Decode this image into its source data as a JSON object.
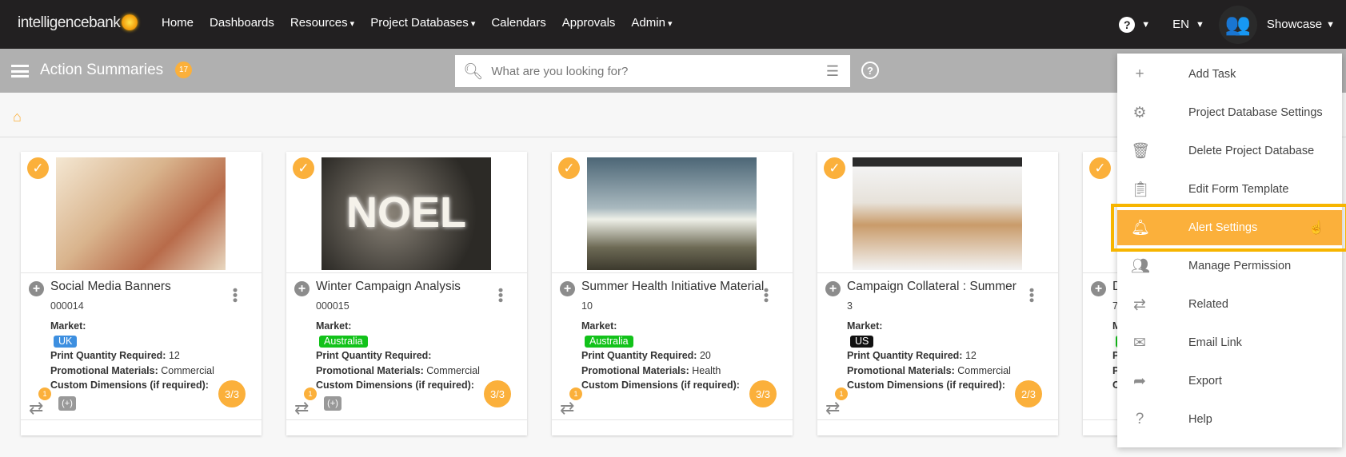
{
  "topbar": {
    "logo": "intelligencebank",
    "nav": [
      "Home",
      "Dashboards",
      "Resources",
      "Project Databases",
      "Calendars",
      "Approvals",
      "Admin"
    ],
    "language": "EN",
    "user": "Showcase"
  },
  "header": {
    "title": "Action Summaries",
    "count": "17",
    "search_placeholder": "What are you looking for?"
  },
  "labels": {
    "market": "Market:",
    "print_qty": "Print Quantity Required:",
    "promo": "Promotional Materials:",
    "custom_dims": "Custom Dimensions (if required):"
  },
  "cards": [
    {
      "title": "Social Media Banners",
      "id": "000014",
      "market": "UK",
      "market_color": "#3d8fe0",
      "print_qty": "12",
      "promo": "Commercial",
      "related": "1",
      "progress": "3/3"
    },
    {
      "title": "Winter Campaign Analysis",
      "id": "000015",
      "market": "Australia",
      "market_color": "#12c21a",
      "print_qty": "",
      "promo": "Commercial",
      "related": "1",
      "progress": "3/3",
      "image_text": "NOEL"
    },
    {
      "title": "Summer Health Initiative Material",
      "id": "10",
      "market": "Australia",
      "market_color": "#12c21a",
      "print_qty": "20",
      "promo": "Health",
      "related": "1",
      "progress": "3/3"
    },
    {
      "title": "Campaign Collateral : Summer",
      "id": "3",
      "market": "US",
      "market_color": "#111111",
      "print_qty": "12",
      "promo": "Commercial",
      "related": "1",
      "progress": "2/3"
    },
    {
      "title": "D",
      "id": "7",
      "market_color": "#12c21a"
    }
  ],
  "menu": [
    {
      "label": "Add Task",
      "icon": "plus-icon"
    },
    {
      "label": "Project Database Settings",
      "icon": "gear-icon"
    },
    {
      "label": "Delete Project Database",
      "icon": "trash-icon"
    },
    {
      "label": "Edit Form Template",
      "icon": "clipboard-icon"
    },
    {
      "label": "Alert Settings",
      "icon": "bell-icon",
      "active": true
    },
    {
      "label": "Manage Permission",
      "icon": "people-icon"
    },
    {
      "label": "Related",
      "icon": "repeat-icon"
    },
    {
      "label": "Email Link",
      "icon": "envelope-icon"
    },
    {
      "label": "Export",
      "icon": "share-icon"
    },
    {
      "label": "Help",
      "icon": "help-icon"
    }
  ],
  "colors": {
    "accent": "#fbb03b",
    "topbar": "#222021",
    "headerbar": "#b0b0b0"
  }
}
